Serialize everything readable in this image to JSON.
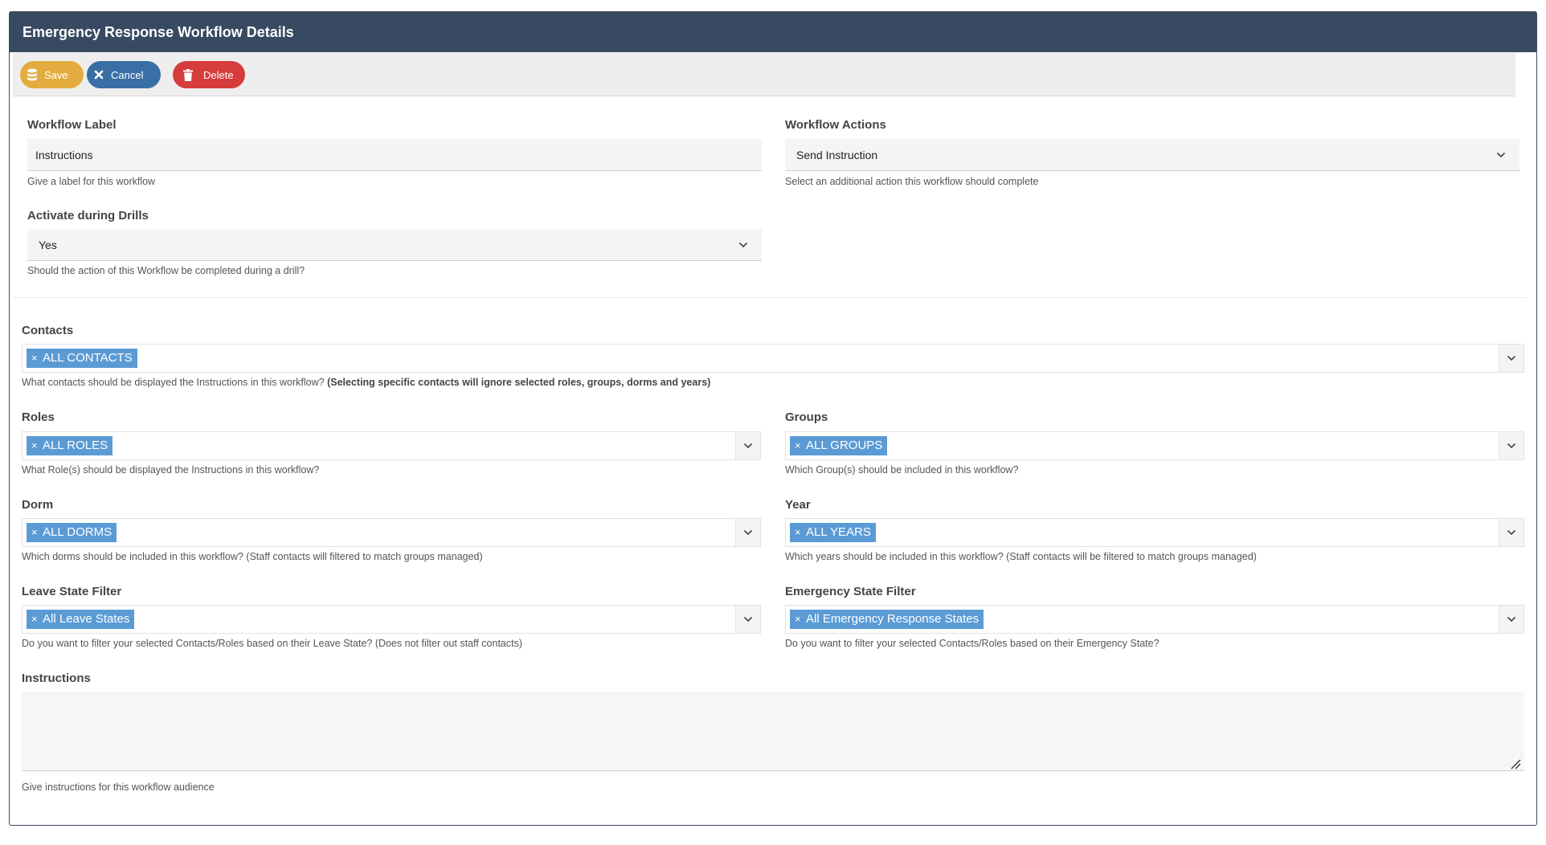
{
  "panel": {
    "title": "Emergency Response Workflow Details"
  },
  "toolbar": {
    "save_label": "Save",
    "cancel_label": "Cancel",
    "delete_label": "Delete"
  },
  "workflow_label": {
    "label": "Workflow Label",
    "value": "Instructions",
    "help": "Give a label for this workflow"
  },
  "workflow_actions": {
    "label": "Workflow Actions",
    "value": "Send Instruction",
    "help": "Select an additional action this workflow should complete"
  },
  "activate_drills": {
    "label": "Activate during Drills",
    "value": "Yes",
    "help": "Should the action of this Workflow be completed during a drill?"
  },
  "contacts": {
    "label": "Contacts",
    "tag": "ALL CONTACTS",
    "help": "What contacts should be displayed the Instructions in this workflow?",
    "help_bold": "(Selecting specific contacts will ignore selected roles, groups, dorms and years)"
  },
  "roles": {
    "label": "Roles",
    "tag": "ALL ROLES",
    "help": "What Role(s) should be displayed the Instructions in this workflow?"
  },
  "groups": {
    "label": "Groups",
    "tag": "ALL GROUPS",
    "help": "Which Group(s) should be included in this workflow?"
  },
  "dorm": {
    "label": "Dorm",
    "tag": "ALL DORMS",
    "help": "Which dorms should be included in this workflow? (Staff contacts will filtered to match groups managed)"
  },
  "year": {
    "label": "Year",
    "tag": "ALL YEARS",
    "help": "Which years should be included in this workflow? (Staff contacts will be filtered to match groups managed)"
  },
  "leave_state": {
    "label": "Leave State Filter",
    "tag": "All Leave States",
    "help": "Do you want to filter your selected Contacts/Roles based on their Leave State? (Does not filter out staff contacts)"
  },
  "emergency_state": {
    "label": "Emergency State Filter",
    "tag": "All Emergency Response States",
    "help": "Do you want to filter your selected Contacts/Roles based on their Emergency State?"
  },
  "instructions": {
    "label": "Instructions",
    "value": "",
    "help": "Give instructions for this workflow audience"
  },
  "tag_remove_symbol": "×",
  "icons": [
    "database-icon",
    "close-icon",
    "trash-icon",
    "chevron-down-icon",
    "resize-handle-icon"
  ],
  "colors": {
    "header": "#374a61",
    "save": "#e3ac3f",
    "cancel": "#3a6fa5",
    "delete": "#d73c3d",
    "tag": "#5b9bd5"
  }
}
